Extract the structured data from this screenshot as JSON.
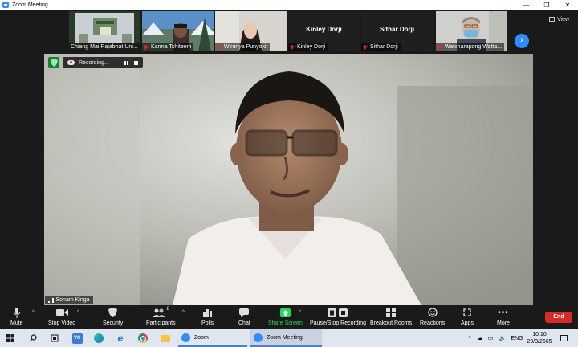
{
  "window": {
    "title": "Zoom Meeting",
    "controls": [
      "—",
      "❐",
      "✕"
    ]
  },
  "view_button": {
    "label": "View"
  },
  "thumbnails": [
    {
      "name": "Chiang Mai Rajabhat Uni...",
      "muted": false,
      "big_name": ""
    },
    {
      "name": "Karma Tshiteem",
      "muted": true,
      "big_name": ""
    },
    {
      "name": "Wirunya Punyokit",
      "muted": true,
      "big_name": ""
    },
    {
      "name": "Kinley Dorji",
      "muted": true,
      "big_name": "Kinley Dorji"
    },
    {
      "name": "Sithar Dorji",
      "muted": true,
      "big_name": "Sithar Dorji"
    },
    {
      "name": "Watcharapong Watta...",
      "muted": true,
      "big_name": ""
    }
  ],
  "recording": {
    "label": "Recording..."
  },
  "active_speaker": {
    "name": "Sonam Kinga"
  },
  "toolbar": {
    "mute": "Mute",
    "stop_video": "Stop Video",
    "security": "Security",
    "participants": "Participants",
    "participants_count": "8",
    "polls": "Polls",
    "chat": "Chat",
    "share_screen": "Share Screen",
    "pause_stop_recording": "Pause/Stop Recording",
    "breakout_rooms": "Breakout Rooms",
    "reactions": "Reactions",
    "apps": "Apps",
    "more": "More",
    "end": "End"
  },
  "taskbar": {
    "apps": [
      {
        "label": "Zoom"
      },
      {
        "label": "Zoom Meeting"
      }
    ],
    "tray": {
      "lang": "ENG",
      "time": "10:10",
      "date": "29/3/2565"
    }
  },
  "colors": {
    "accent": "#2d8cff",
    "share_green": "#23d959",
    "end_red": "#d92a2a",
    "muted_red": "#e02828"
  }
}
